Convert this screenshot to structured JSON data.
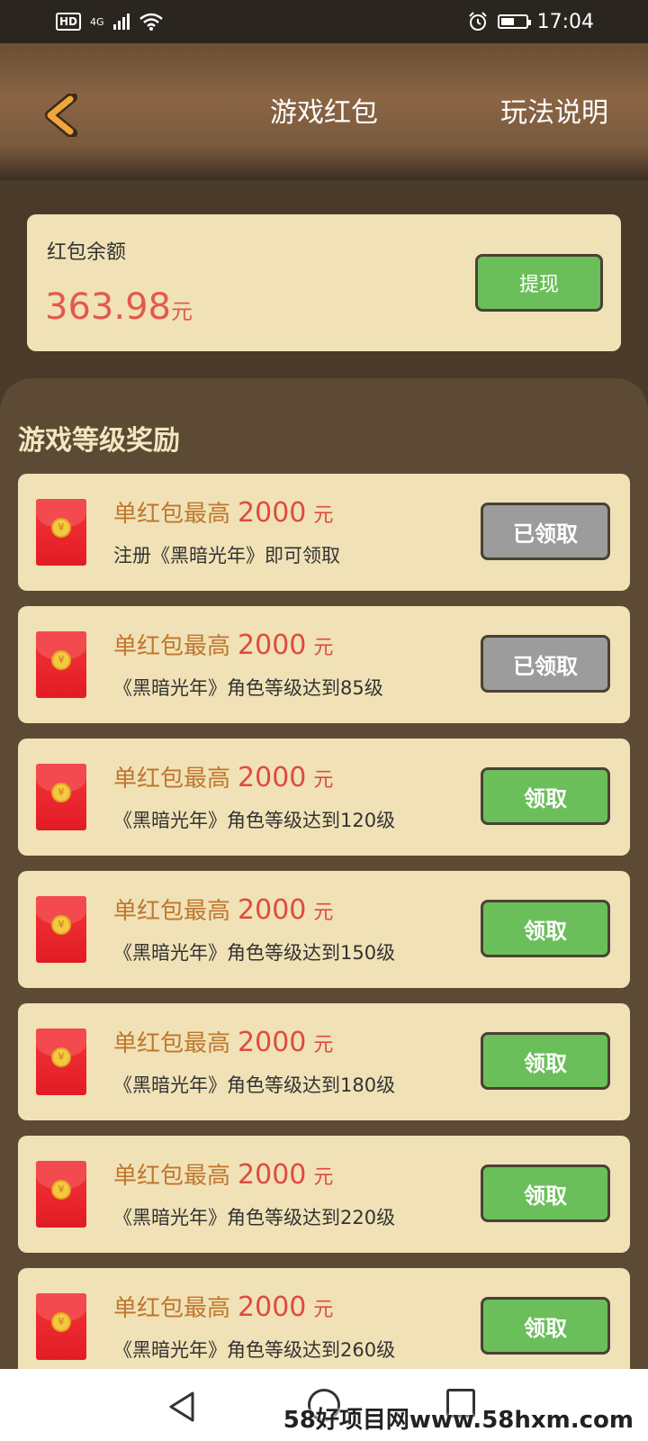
{
  "status_bar": {
    "hd": "HD",
    "network": "4G",
    "time": "17:04",
    "battery_level": 0.55
  },
  "header": {
    "title": "游戏红包",
    "rules_link": "玩法说明"
  },
  "balance": {
    "label": "红包余额",
    "amount": "363.98",
    "unit": "元",
    "withdraw_label": "提现"
  },
  "rewards": {
    "section_title": "游戏等级奖励",
    "items": [
      {
        "prefix": "单红包最高",
        "amount": "2000",
        "unit": "元",
        "condition": "注册《黑暗光年》即可领取",
        "button": "已领取",
        "state": "claimed"
      },
      {
        "prefix": "单红包最高",
        "amount": "2000",
        "unit": "元",
        "condition": "《黑暗光年》角色等级达到85级",
        "button": "已领取",
        "state": "claimed"
      },
      {
        "prefix": "单红包最高",
        "amount": "2000",
        "unit": "元",
        "condition": "《黑暗光年》角色等级达到120级",
        "button": "领取",
        "state": "available"
      },
      {
        "prefix": "单红包最高",
        "amount": "2000",
        "unit": "元",
        "condition": "《黑暗光年》角色等级达到150级",
        "button": "领取",
        "state": "available"
      },
      {
        "prefix": "单红包最高",
        "amount": "2000",
        "unit": "元",
        "condition": "《黑暗光年》角色等级达到180级",
        "button": "领取",
        "state": "available"
      },
      {
        "prefix": "单红包最高",
        "amount": "2000",
        "unit": "元",
        "condition": "《黑暗光年》角色等级达到220级",
        "button": "领取",
        "state": "available"
      },
      {
        "prefix": "单红包最高",
        "amount": "2000",
        "unit": "元",
        "condition": "《黑暗光年》角色等级达到260级",
        "button": "领取",
        "state": "available"
      }
    ]
  },
  "envelope_coin": "¥",
  "watermark": "58好项目网www.58hxm.com",
  "colors": {
    "accent_red": "#e35a4b",
    "button_green": "#6bbf5a",
    "button_gray": "#9c9c9c",
    "card_bg": "#f0e2b6",
    "panel_bg": "#5c4a34"
  }
}
